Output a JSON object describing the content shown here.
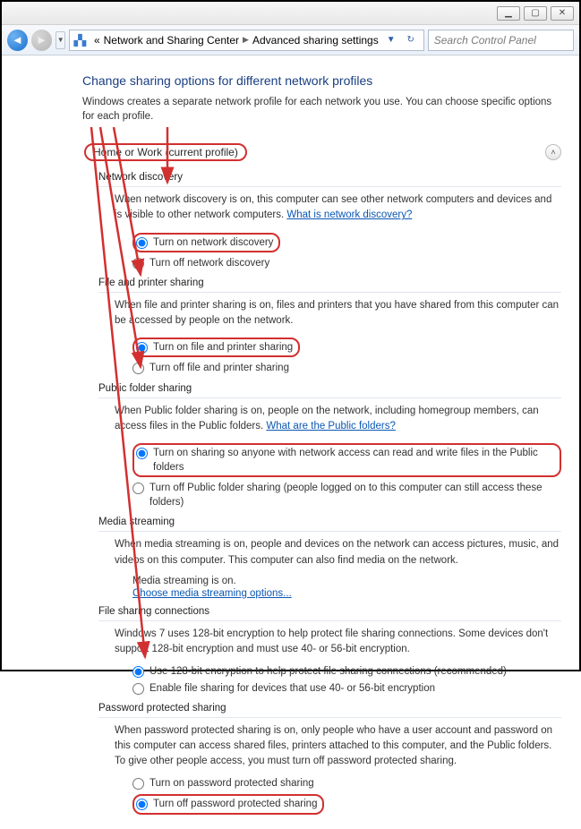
{
  "titlebar_buttons": [
    "–",
    "▢",
    "✕"
  ],
  "breadcrumb": {
    "item1": "Network and Sharing Center",
    "item2": "Advanced sharing settings"
  },
  "search": {
    "placeholder": "Search Control Panel"
  },
  "page": {
    "title": "Change sharing options for different network profiles",
    "desc": "Windows creates a separate network profile for each network you use. You can choose specific options for each profile."
  },
  "profile_header": "Home or Work (current profile)",
  "sections": {
    "network_discovery": {
      "title": "Network discovery",
      "desc_a": "When network discovery is on, this computer can see other network computers and devices and is visible to other network computers. ",
      "link": "What is network discovery?",
      "opt_on": "Turn on network discovery",
      "opt_off": "Turn off network discovery"
    },
    "file_printer": {
      "title": "File and printer sharing",
      "desc": "When file and printer sharing is on, files and printers that you have shared from this computer can be accessed by people on the network.",
      "opt_on": "Turn on file and printer sharing",
      "opt_off": "Turn off file and printer sharing"
    },
    "public_folder": {
      "title": "Public folder sharing",
      "desc_a": "When Public folder sharing is on, people on the network, including homegroup members, can access files in the Public folders. ",
      "link": "What are the Public folders?",
      "opt_on": "Turn on sharing so anyone with network access can read and write files in the Public folders",
      "opt_off": "Turn off Public folder sharing (people logged on to this computer can still access these folders)"
    },
    "media": {
      "title": "Media streaming",
      "desc": "When media streaming is on, people and devices on the network can access pictures, music, and videos on this computer. This computer can also find media on the network.",
      "status": "Media streaming is on.",
      "link": "Choose media streaming options..."
    },
    "file_conn": {
      "title": "File sharing connections",
      "desc": "Windows 7 uses 128-bit encryption to help protect file sharing connections. Some devices don't support 128-bit encryption and must use 40- or 56-bit encryption.",
      "opt_on": "Use 128-bit encryption to help protect file sharing connections (recommended)",
      "opt_off": "Enable file sharing for devices that use 40- or 56-bit encryption"
    },
    "password": {
      "title": "Password protected sharing",
      "desc": "When password protected sharing is on, only people who have a user account and password on this computer can access shared files, printers attached to this computer, and the Public folders. To give other people access, you must turn off password protected sharing.",
      "opt_on": "Turn on password protected sharing",
      "opt_off": "Turn off password protected sharing"
    }
  }
}
